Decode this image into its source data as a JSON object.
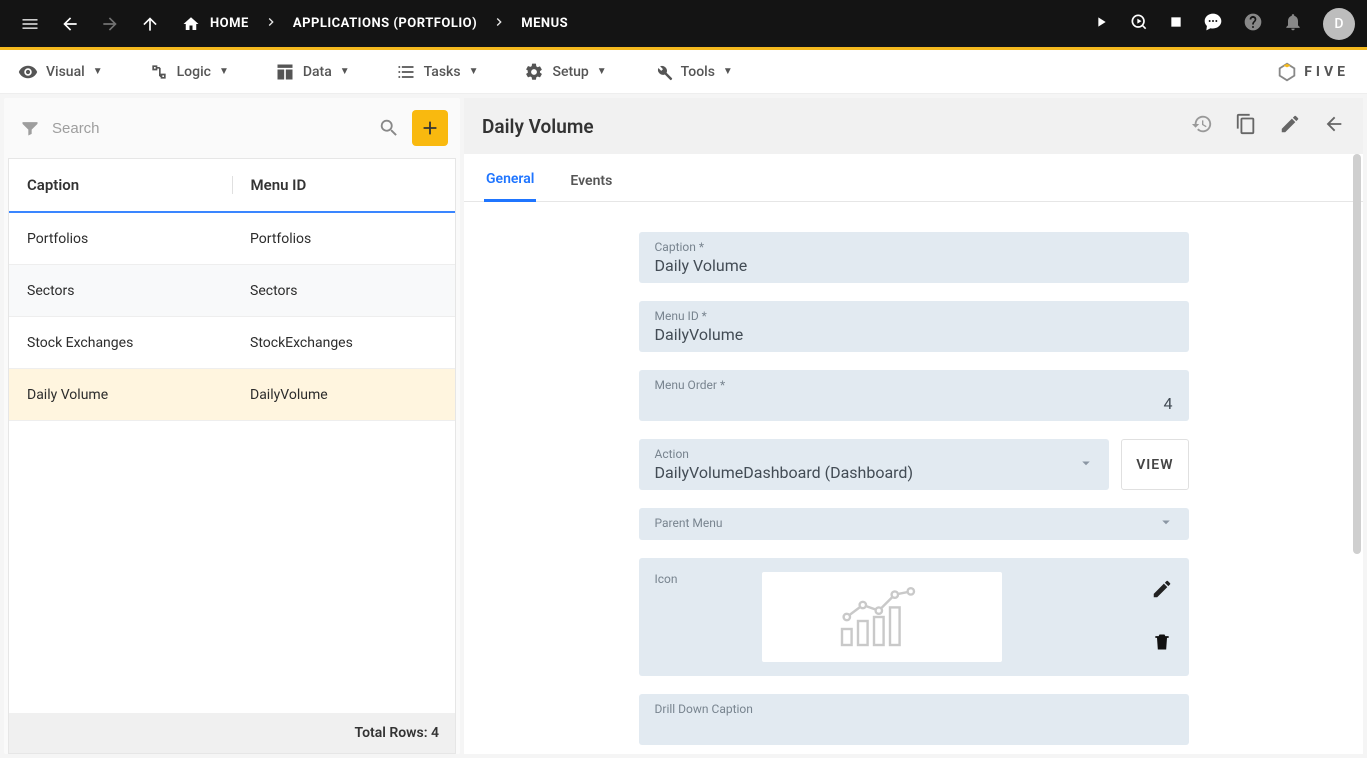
{
  "topbar": {
    "home": "HOME",
    "apps": "APPLICATIONS (PORTFOLIO)",
    "menus": "MENUS",
    "avatar": "D"
  },
  "menubar": {
    "visual": "Visual",
    "logic": "Logic",
    "data": "Data",
    "tasks": "Tasks",
    "setup": "Setup",
    "tools": "Tools",
    "brand": "FIVE"
  },
  "left": {
    "search_placeholder": "Search",
    "col_caption": "Caption",
    "col_menuid": "Menu ID",
    "rows": [
      {
        "caption": "Portfolios",
        "menuid": "Portfolios"
      },
      {
        "caption": "Sectors",
        "menuid": "Sectors"
      },
      {
        "caption": "Stock Exchanges",
        "menuid": "StockExchanges"
      },
      {
        "caption": "Daily Volume",
        "menuid": "DailyVolume"
      }
    ],
    "footer_label": "Total Rows:",
    "footer_count": "4"
  },
  "detail": {
    "title": "Daily Volume",
    "tabs": {
      "general": "General",
      "events": "Events"
    },
    "fields": {
      "caption_label": "Caption *",
      "caption_value": "Daily Volume",
      "menuid_label": "Menu ID *",
      "menuid_value": "DailyVolume",
      "order_label": "Menu Order *",
      "order_value": "4",
      "action_label": "Action",
      "action_value": "DailyVolumeDashboard (Dashboard)",
      "view_btn": "VIEW",
      "parent_label": "Parent Menu",
      "parent_value": "",
      "icon_label": "Icon",
      "drill_label": "Drill Down Caption"
    }
  }
}
